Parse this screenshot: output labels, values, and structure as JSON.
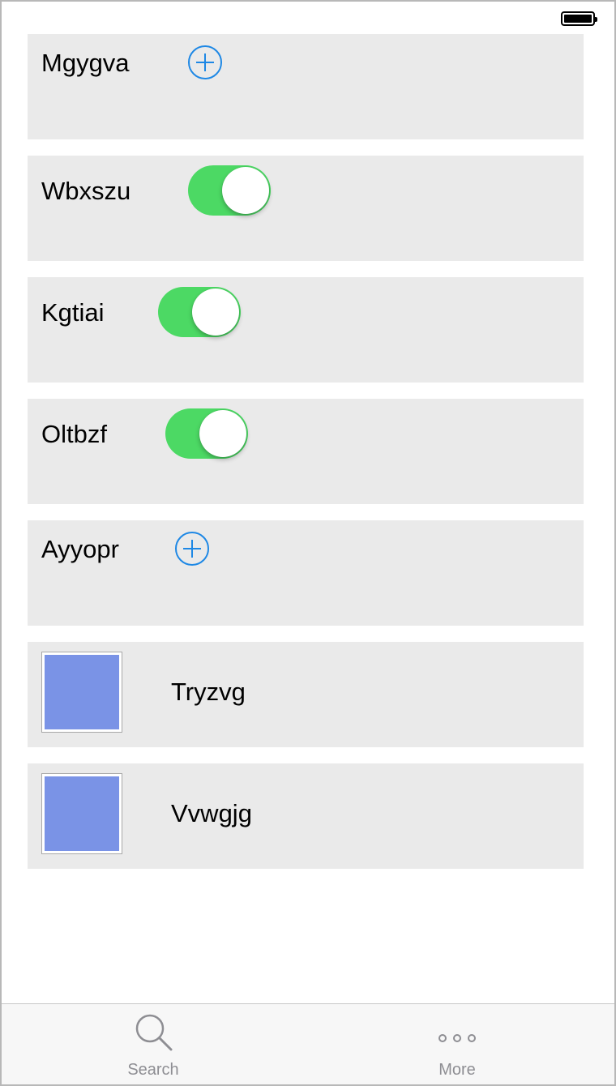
{
  "status_bar": {
    "battery_icon": "battery-full-icon"
  },
  "rows": [
    {
      "type": "add",
      "label": "Mgygva",
      "control_icon": "plus-circle-icon"
    },
    {
      "type": "toggle",
      "label": "Wbxszu",
      "toggle_on": true
    },
    {
      "type": "toggle",
      "label": "Kgtiai",
      "toggle_on": true
    },
    {
      "type": "toggle",
      "label": "Oltbzf",
      "toggle_on": true
    },
    {
      "type": "add",
      "label": "Ayyopr",
      "control_icon": "plus-circle-icon"
    },
    {
      "type": "image",
      "label": "Tryzvg",
      "image_color": "#7a93e6"
    },
    {
      "type": "image",
      "label": "Vvwgjg",
      "image_color": "#7a93e6"
    }
  ],
  "tab_bar": {
    "tabs": [
      {
        "label": "Search",
        "icon": "search-icon"
      },
      {
        "label": "More",
        "icon": "more-icon"
      }
    ]
  },
  "colors": {
    "toggle_on": "#4cd964",
    "accent_blue": "#1e88e5",
    "row_background": "#eaeaea",
    "tab_label": "#8e8e93"
  }
}
